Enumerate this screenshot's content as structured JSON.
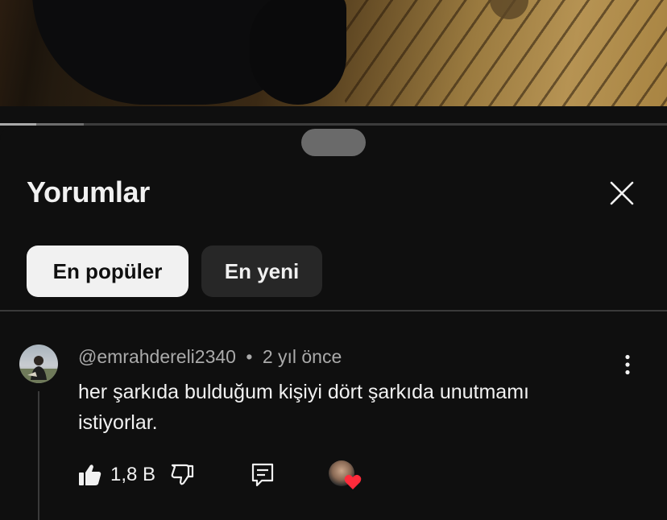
{
  "video": {
    "progress_played_percent": 5.4
  },
  "sheet": {
    "title": "Yorumlar",
    "close_icon": "close-icon",
    "filters": [
      {
        "label": "En popüler",
        "selected": true
      },
      {
        "label": "En yeni",
        "selected": false
      }
    ]
  },
  "comment": {
    "author": "@emrahdereli2340",
    "separator": "•",
    "time": "2 yıl önce",
    "text": "her şarkıda bulduğum kişiyi dört şarkıda unutmamı istiyorlar.",
    "like_count": "1,8 B",
    "icons": [
      "thumbs-up-icon",
      "thumbs-down-icon",
      "reply-icon",
      "creator-heart-icon",
      "more-vert-icon"
    ]
  },
  "colors": {
    "background": "#0f0f0f",
    "text_primary": "#f1f1f1",
    "text_secondary": "#aaaaaa",
    "chip_active_bg": "#f1f1f1",
    "chip_inactive_bg": "#272727",
    "heart": "#ff2b3b"
  }
}
